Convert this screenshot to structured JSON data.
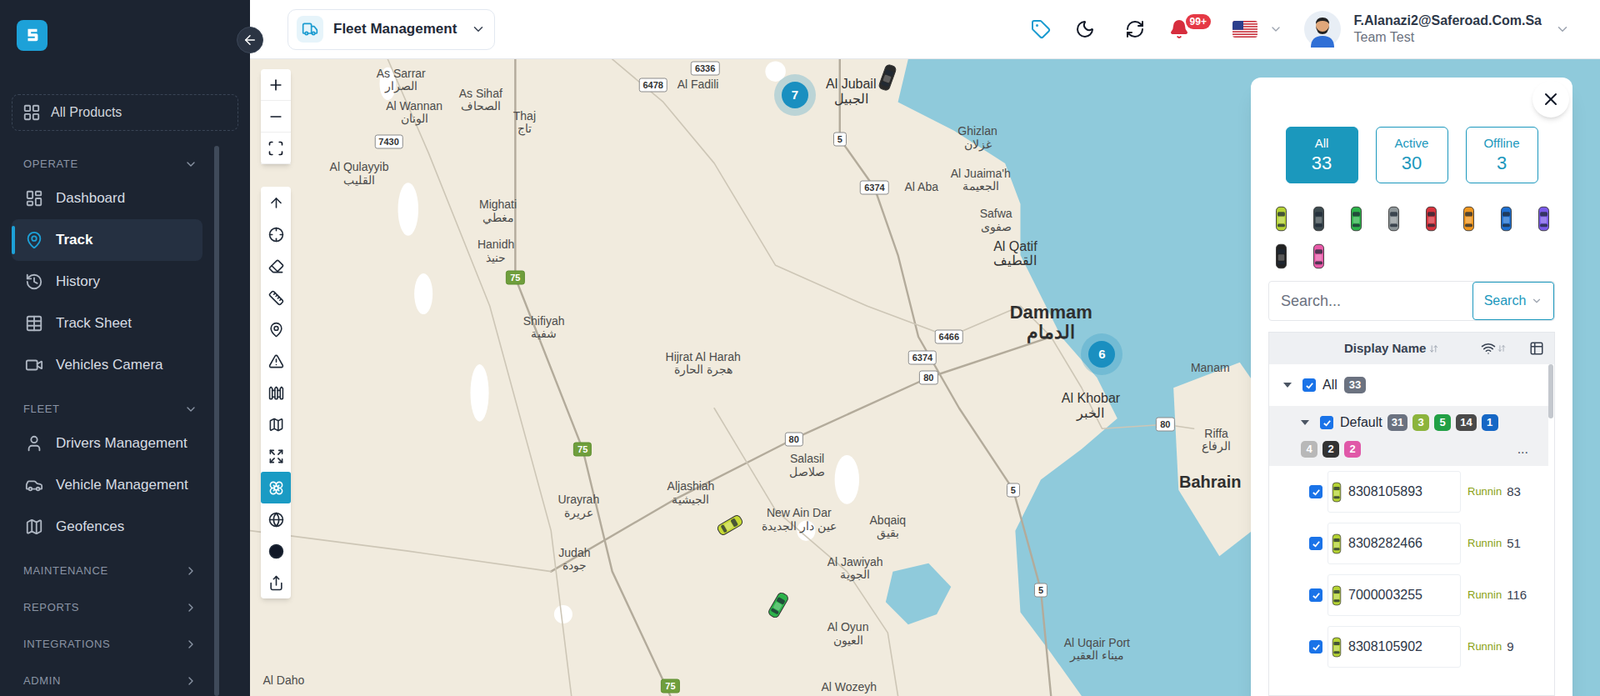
{
  "app": {
    "product_switcher": "Fleet Management",
    "notifications_badge": "99+",
    "user": {
      "email": "F.Alanazi2@Saferoad.Com.Sa",
      "team": "Team Test"
    }
  },
  "sidebar": {
    "all_products": "All Products",
    "sections": [
      {
        "title": "OPERATE",
        "expanded": true,
        "items": [
          {
            "label": "Dashboard",
            "selected": false
          },
          {
            "label": "Track",
            "selected": true
          },
          {
            "label": "History",
            "selected": false
          },
          {
            "label": "Track Sheet",
            "selected": false
          },
          {
            "label": "Vehicles Camera",
            "selected": false
          }
        ]
      },
      {
        "title": "FLEET",
        "expanded": true,
        "items": [
          {
            "label": "Drivers Management",
            "selected": false
          },
          {
            "label": "Vehicle Management",
            "selected": false
          },
          {
            "label": "Geofences",
            "selected": false
          }
        ]
      },
      {
        "title": "MAINTENANCE",
        "expanded": false,
        "items": []
      },
      {
        "title": "REPORTS",
        "expanded": false,
        "items": []
      },
      {
        "title": "INTEGRATIONS",
        "expanded": false,
        "items": []
      },
      {
        "title": "ADMIN",
        "expanded": false,
        "items": []
      }
    ]
  },
  "map": {
    "labels": [
      {
        "en": "As Sarrar",
        "ar": "الصرار",
        "kind": "town"
      },
      {
        "en": "Al Wannan",
        "ar": "الونان",
        "kind": "town"
      },
      {
        "en": "As Sihaf",
        "ar": "الصحاف",
        "kind": "town"
      },
      {
        "en": "Thaj",
        "ar": "تاج",
        "kind": "town"
      },
      {
        "en": "Al Fadili",
        "kind": "town"
      },
      {
        "en": "Al Qulayyib",
        "ar": "القليب",
        "kind": "town"
      },
      {
        "en": "Mighati",
        "ar": "مغطي",
        "kind": "town"
      },
      {
        "en": "Hanidh",
        "ar": "حنيذ",
        "kind": "town"
      },
      {
        "en": "Shifiyah",
        "ar": "شفية",
        "kind": "town"
      },
      {
        "en": "Hijrat Al Harah",
        "ar": "هجرة الحارة",
        "kind": "town"
      },
      {
        "en": "Al Jubail",
        "ar": "الجبيل",
        "kind": "major"
      },
      {
        "en": "Ghizlan",
        "ar": "غزلان",
        "kind": "town"
      },
      {
        "en": "Al Aba",
        "kind": "town"
      },
      {
        "en": "Al Juaima'h",
        "ar": "الجعيمة",
        "kind": "town"
      },
      {
        "en": "Safwa",
        "ar": "صفوى",
        "kind": "town"
      },
      {
        "en": "Al Qatif",
        "ar": "القطيف",
        "kind": "major"
      },
      {
        "en": "Dammam",
        "ar": "الدمام",
        "kind": "city"
      },
      {
        "en": "Al Khobar",
        "ar": "الخبر",
        "kind": "major"
      },
      {
        "en": "Manam",
        "kind": "town"
      },
      {
        "en": "Riffa",
        "ar": "الرفاع",
        "kind": "town"
      },
      {
        "en": "Bahrain",
        "kind": "country"
      },
      {
        "en": "Salasil",
        "ar": "صلاصل",
        "kind": "town"
      },
      {
        "en": "Aljashiah",
        "ar": "الجيشية",
        "kind": "town"
      },
      {
        "en": "Urayrah",
        "ar": "عريرة",
        "kind": "town"
      },
      {
        "en": "New Ain Dar",
        "ar": "عين دار الجديدة",
        "kind": "town"
      },
      {
        "en": "Abqaiq",
        "ar": "بقيق",
        "kind": "town"
      },
      {
        "en": "Judah",
        "ar": "جودة",
        "kind": "town"
      },
      {
        "en": "Al Jawiyah",
        "ar": "الجوية",
        "kind": "town"
      },
      {
        "en": "Al Oyun",
        "ar": "العيون",
        "kind": "town"
      },
      {
        "en": "Al Uqair Port",
        "ar": "ميناء العقير",
        "kind": "town"
      },
      {
        "en": "Al Daho",
        "kind": "town"
      },
      {
        "en": "Al Wozeyh",
        "kind": "town"
      }
    ],
    "road_shields": [
      {
        "label": "6336",
        "color": "#ffffff"
      },
      {
        "label": "6478",
        "color": "#ffffff"
      },
      {
        "label": "7430",
        "color": "#ffffff"
      },
      {
        "label": "5",
        "color": "#ffffff"
      },
      {
        "label": "6374",
        "color": "#ffffff"
      },
      {
        "label": "6466",
        "color": "#ffffff"
      },
      {
        "label": "6374",
        "color": "#ffffff"
      },
      {
        "label": "80",
        "color": "#ffffff"
      },
      {
        "label": "80",
        "color": "#ffffff"
      },
      {
        "label": "80",
        "color": "#ffffff"
      },
      {
        "label": "75",
        "color": "#9cc46b"
      },
      {
        "label": "75",
        "color": "#9cc46b"
      },
      {
        "label": "75",
        "color": "#9cc46b"
      },
      {
        "label": "5",
        "color": "#ffffff"
      },
      {
        "label": "5",
        "color": "#ffffff"
      }
    ],
    "clusters": [
      {
        "count": "7"
      },
      {
        "count": "6"
      }
    ],
    "vehicles": [
      {
        "color": "#2a2a2a"
      },
      {
        "color": "#c6d934"
      },
      {
        "color": "#2db34a"
      }
    ]
  },
  "map_tools": [
    {
      "selected": false
    },
    {
      "selected": false
    },
    {
      "selected": false
    },
    {
      "selected": false
    },
    {
      "selected": false
    },
    {
      "selected": false
    },
    {
      "selected": false
    },
    {
      "selected": false
    },
    {
      "selected": false
    },
    {
      "selected": true
    },
    {
      "selected": false
    },
    {
      "selected": false
    },
    {
      "selected": false
    }
  ],
  "panel": {
    "filters": [
      {
        "label": "All",
        "count": "33",
        "selected": true
      },
      {
        "label": "Active",
        "count": "30",
        "selected": false
      },
      {
        "label": "Offline",
        "count": "3",
        "selected": false
      }
    ],
    "color_filters": [
      {
        "color": "#b5d334"
      },
      {
        "color": "#3d4a4f"
      },
      {
        "color": "#2db34a"
      },
      {
        "color": "#8e9699"
      },
      {
        "color": "#d8323c"
      },
      {
        "color": "#f0961e"
      },
      {
        "color": "#1d6fd1"
      },
      {
        "color": "#7a5ae8"
      },
      {
        "color": "#222222"
      },
      {
        "color": "#e85aa8"
      }
    ],
    "search": {
      "placeholder": "Search...",
      "button": "Search"
    },
    "columns": {
      "name": "Display Name"
    },
    "tree": {
      "all": {
        "label": "All",
        "count": "33",
        "checked": true,
        "expanded": true
      },
      "group": {
        "label": "Default",
        "checked": true,
        "expanded": true,
        "more": "...",
        "counts": [
          {
            "count": "31",
            "color": "#6b7280"
          },
          {
            "count": "3",
            "color": "#8cb43c"
          },
          {
            "count": "5",
            "color": "#22a045"
          },
          {
            "count": "14",
            "color": "#4a4a4a"
          },
          {
            "count": "1",
            "color": "#1667c5"
          },
          {
            "count": "4",
            "color": "#b8b8b8"
          },
          {
            "count": "2",
            "color": "#333333"
          },
          {
            "count": "2",
            "color": "#e058a8"
          }
        ]
      }
    },
    "rows": [
      {
        "name": "8308105893",
        "status": "Runnin",
        "speed": "83",
        "checked": true,
        "color": "#b5d334"
      },
      {
        "name": "8308282466",
        "status": "Runnin",
        "speed": "51",
        "checked": true,
        "color": "#b5d334"
      },
      {
        "name": "7000003255",
        "status": "Runnin",
        "speed": "116",
        "checked": true,
        "color": "#b5d334"
      },
      {
        "name": "8308105902",
        "status": "Runnin",
        "speed": "9",
        "checked": true,
        "color": "#b5d334"
      }
    ]
  }
}
